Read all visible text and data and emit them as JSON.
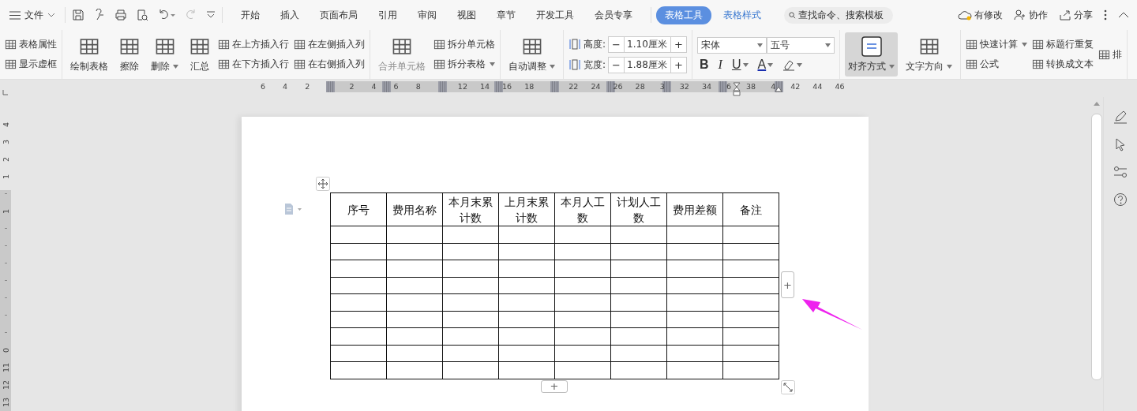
{
  "menu": {
    "label": "文件"
  },
  "tabs": [
    {
      "label": "开始",
      "kind": "normal",
      "selected": false
    },
    {
      "label": "插入",
      "kind": "normal",
      "selected": false
    },
    {
      "label": "页面布局",
      "kind": "normal",
      "selected": false
    },
    {
      "label": "引用",
      "kind": "normal",
      "selected": false
    },
    {
      "label": "审阅",
      "kind": "normal",
      "selected": false
    },
    {
      "label": "视图",
      "kind": "normal",
      "selected": false
    },
    {
      "label": "章节",
      "kind": "normal",
      "selected": false
    },
    {
      "label": "开发工具",
      "kind": "normal",
      "selected": false
    },
    {
      "label": "会员专享",
      "kind": "normal",
      "selected": false
    },
    {
      "label": "表格工具",
      "kind": "context",
      "selected": true
    },
    {
      "label": "表格样式",
      "kind": "context",
      "selected": false
    }
  ],
  "search": {
    "placeholder": "查找命令、搜索模板"
  },
  "top_actions": [
    {
      "label": "有修改"
    },
    {
      "label": "协作"
    },
    {
      "label": "分享"
    }
  ],
  "ribbon": [
    {
      "columns": [
        {
          "kind": "stack",
          "buttons": [
            {
              "label": "表格属性",
              "dropdown": false
            },
            {
              "label": "显示虚框",
              "dropdown": false
            }
          ]
        }
      ]
    },
    {
      "columns": [
        {
          "kind": "large",
          "label": "绘制表格",
          "dropdown": false,
          "disabled": false,
          "selected": false
        },
        {
          "kind": "large",
          "label": "擦除",
          "dropdown": false,
          "disabled": false,
          "selected": false
        },
        {
          "kind": "large",
          "label": "删除",
          "dropdown": true,
          "disabled": false,
          "selected": false
        },
        {
          "kind": "large",
          "label": "汇总",
          "dropdown": false,
          "disabled": false,
          "selected": false
        },
        {
          "kind": "stack",
          "buttons": [
            {
              "label": "在上方插入行",
              "dropdown": false
            },
            {
              "label": "在下方插入行",
              "dropdown": false
            }
          ]
        },
        {
          "kind": "stack",
          "buttons": [
            {
              "label": "在左侧插入列",
              "dropdown": false
            },
            {
              "label": "在右侧插入列",
              "dropdown": false
            }
          ]
        }
      ]
    },
    {
      "columns": [
        {
          "kind": "large",
          "label": "合并单元格",
          "dropdown": false,
          "disabled": true,
          "selected": false
        },
        {
          "kind": "stack",
          "buttons": [
            {
              "label": "拆分单元格",
              "dropdown": false
            },
            {
              "label": "拆分表格",
              "dropdown": true
            }
          ]
        }
      ]
    },
    {
      "columns": [
        {
          "kind": "large",
          "label": "自动调整",
          "dropdown": true,
          "disabled": false,
          "selected": false
        }
      ]
    },
    {
      "columns": [
        {
          "kind": "spin",
          "rows": [
            {
              "label": "高度:",
              "value": "1.10厘米",
              "minus": "−",
              "plus": "+"
            },
            {
              "label": "宽度:",
              "value": "1.88厘米",
              "minus": "−",
              "plus": "+"
            }
          ]
        }
      ]
    },
    {
      "columns": [
        {
          "kind": "font",
          "fields": [
            {
              "value": "宋体"
            },
            {
              "value": "五号"
            }
          ],
          "format": [
            {
              "kind": "text",
              "label": "B",
              "dropdown": false
            },
            {
              "kind": "text",
              "label": "I",
              "dropdown": false
            },
            {
              "kind": "text",
              "label": "U",
              "dropdown": true
            },
            {
              "kind": "text",
              "label": "A",
              "dropdown": true
            },
            {
              "kind": "icon",
              "dropdown": true
            }
          ]
        }
      ]
    },
    {
      "columns": [
        {
          "kind": "large",
          "label": "对齐方式",
          "dropdown": true,
          "disabled": false,
          "selected": true
        },
        {
          "kind": "large",
          "label": "文字方向",
          "dropdown": true,
          "disabled": false,
          "selected": false
        }
      ]
    },
    {
      "columns": [
        {
          "kind": "stack",
          "buttons": [
            {
              "label": "快速计算",
              "dropdown": true
            },
            {
              "label": "公式",
              "dropdown": false
            }
          ]
        },
        {
          "kind": "stack",
          "buttons": [
            {
              "label": "标题行重复",
              "dropdown": false
            },
            {
              "label": "转换成文本",
              "dropdown": false
            }
          ]
        },
        {
          "kind": "stack",
          "buttons": [
            {
              "label": "排",
              "dropdown": false
            }
          ]
        }
      ]
    }
  ],
  "ruler": [
    {
      "kind": "number",
      "text": "6"
    },
    {
      "kind": "number",
      "text": "4"
    },
    {
      "kind": "number",
      "text": "2"
    },
    {
      "kind": "gap"
    },
    {
      "kind": "number",
      "text": "2"
    },
    {
      "kind": "number",
      "text": "4"
    },
    {
      "kind": "number",
      "text": "6"
    },
    {
      "kind": "number",
      "text": "8"
    },
    {
      "kind": "gap"
    },
    {
      "kind": "number",
      "text": "12"
    },
    {
      "kind": "number",
      "text": "14"
    },
    {
      "kind": "number",
      "text": "16"
    },
    {
      "kind": "number",
      "text": "18"
    },
    {
      "kind": "gap"
    },
    {
      "kind": "number",
      "text": "22"
    },
    {
      "kind": "number",
      "text": "24"
    },
    {
      "kind": "number",
      "text": "26"
    },
    {
      "kind": "number",
      "text": "28"
    },
    {
      "kind": "number",
      "text": "3"
    },
    {
      "kind": "number",
      "text": "32"
    },
    {
      "kind": "number",
      "text": "34"
    },
    {
      "kind": "number",
      "text": "6"
    },
    {
      "kind": "number",
      "text": "38"
    },
    {
      "kind": "number",
      "text": "4"
    },
    {
      "kind": "number",
      "text": "42"
    },
    {
      "kind": "number",
      "text": "44"
    },
    {
      "kind": "number",
      "text": "46"
    }
  ],
  "vertical_ruler": [
    {
      "kind": "number",
      "text": "4"
    },
    {
      "kind": "number",
      "text": "3"
    },
    {
      "kind": "number",
      "text": "2"
    },
    {
      "kind": "number",
      "text": "1"
    },
    {
      "kind": "gap"
    },
    {
      "kind": "number",
      "text": "1"
    },
    {
      "kind": "gap"
    },
    {
      "kind": "gap"
    },
    {
      "kind": "gap"
    },
    {
      "kind": "gap"
    },
    {
      "kind": "gap"
    },
    {
      "kind": "gap"
    },
    {
      "kind": "gap"
    },
    {
      "kind": "number",
      "text": "0"
    },
    {
      "kind": "number",
      "text": "11"
    },
    {
      "kind": "number",
      "text": "12"
    },
    {
      "kind": "number",
      "text": "13"
    }
  ],
  "table": {
    "columns": [
      "序号",
      "费用名称",
      "本月末累计数",
      "上月末累计数",
      "本月人工数",
      "计划人工数",
      "费用差额",
      "备注"
    ],
    "rows": [
      {
        "kind": "empty"
      },
      {
        "kind": "empty"
      },
      {
        "kind": "empty"
      },
      {
        "kind": "empty"
      },
      {
        "kind": "empty"
      },
      {
        "kind": "empty"
      },
      {
        "kind": "empty"
      },
      {
        "kind": "empty"
      },
      {
        "kind": "empty"
      }
    ],
    "add_column": "+",
    "add_row": "+"
  }
}
